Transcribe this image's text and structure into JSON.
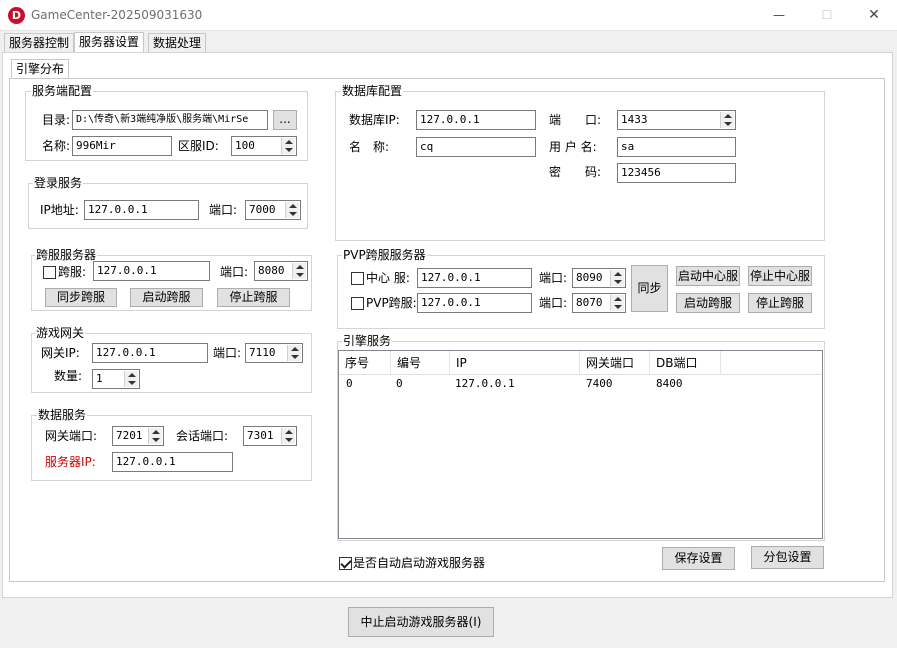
{
  "window": {
    "title": "GameCenter-202509031630",
    "icon_letter": "D",
    "minimize_glyph": "—",
    "maximize_glyph": "☐",
    "close_glyph": "✕"
  },
  "tabs": [
    "服务器控制",
    "服务器设置",
    "数据处理"
  ],
  "subtab": "引擎分布",
  "server_config": {
    "legend": "服务端配置",
    "dir_label": "目录:",
    "dir_value": "D:\\传奇\\新3端纯净版\\服务端\\MirSe",
    "browse_label": "...",
    "name_label": "名称:",
    "name_value": "996Mir",
    "zone_label": "区服ID:",
    "zone_value": "100"
  },
  "login_service": {
    "legend": "登录服务",
    "ip_label": "IP地址:",
    "ip_value": "127.0.0.1",
    "port_label": "端口:",
    "port_value": "7000"
  },
  "cross_server": {
    "legend": "跨服服务器",
    "check_label": "跨服:",
    "ip_value": "127.0.0.1",
    "port_label": "端口:",
    "port_value": "8080",
    "sync_btn": "同步跨服",
    "start_btn": "启动跨服",
    "stop_btn": "停止跨服"
  },
  "gateway": {
    "legend": "游戏网关",
    "ip_label": "网关IP:",
    "ip_value": "127.0.0.1",
    "port_label": "端口:",
    "port_value": "7110",
    "count_label": "数量:",
    "count_value": "1"
  },
  "data_service": {
    "legend": "数据服务",
    "gw_port_label": "网关端口:",
    "gw_port_value": "7201",
    "session_port_label": "会话端口:",
    "session_port_value": "7301",
    "server_ip_label": "服务器IP:",
    "server_ip_value": "127.0.0.1"
  },
  "database": {
    "legend": "数据库配置",
    "ip_label": "数据库IP:",
    "ip_value": "127.0.0.1",
    "port_label": "端　　口:",
    "port_value": "1433",
    "name_label": "名　称:",
    "name_value": "cq",
    "user_label": "用 户 名:",
    "user_value": "sa",
    "pwd_label": "密　　码:",
    "pwd_value": "123456"
  },
  "pvp": {
    "legend": "PVP跨服服务器",
    "center_label": "中心 服:",
    "center_ip": "127.0.0.1",
    "center_port_label": "端口:",
    "center_port": "8090",
    "pvp_label": "PVP跨服:",
    "pvp_ip": "127.0.0.1",
    "pvp_port_label": "端口:",
    "pvp_port": "8070",
    "sync_btn": "同步",
    "start_center_btn": "启动中心服",
    "stop_center_btn": "停止中心服",
    "start_cross_btn": "启动跨服",
    "stop_cross_btn": "停止跨服"
  },
  "engine": {
    "legend": "引擎服务",
    "columns": [
      "序号",
      "编号",
      "IP",
      "网关端口",
      "DB端口"
    ],
    "rows": [
      [
        "0",
        "0",
        "127.0.0.1",
        "7400",
        "8400"
      ]
    ]
  },
  "autostart": {
    "label": "是否自动启动游戏服务器",
    "checked": true
  },
  "save_btn": "保存设置",
  "package_btn": "分包设置",
  "stop_all_btn": "中止启动游戏服务器(I)",
  "colors": {
    "title_icon": "#c8102e",
    "server_ip_label": "#cc0000"
  }
}
